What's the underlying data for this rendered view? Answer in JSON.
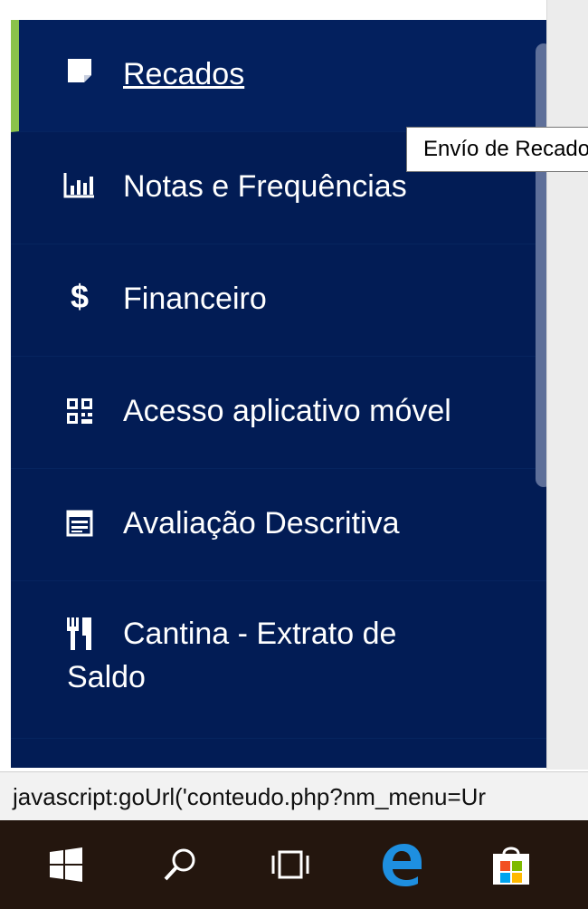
{
  "menu": {
    "items": [
      {
        "label": "Recados",
        "icon": "sticky-note-icon"
      },
      {
        "label": "Notas e Frequências",
        "icon": "bar-chart-icon"
      },
      {
        "label": "Financeiro",
        "icon": "dollar-icon"
      },
      {
        "label": "Acesso aplicativo móvel",
        "icon": "qr-code-icon"
      },
      {
        "label": "Avaliação Descritiva",
        "icon": "calendar-icon"
      },
      {
        "label": "Cantina - Extrato de Saldo",
        "icon": "utensils-icon"
      }
    ],
    "active_index": 0
  },
  "tooltip": {
    "text": "Envío de Recados"
  },
  "statusbar": {
    "text": "javascript:goUrl('conteudo.php?nm_menu=Ur"
  },
  "taskbar": {
    "items": [
      "windows-start-icon",
      "search-icon",
      "task-view-icon",
      "edge-browser-icon",
      "microsoft-store-icon"
    ]
  },
  "colors": {
    "sidebar_bg": "#021c55",
    "active_accent": "#8bc34a",
    "taskbar_bg": "#24160e"
  }
}
